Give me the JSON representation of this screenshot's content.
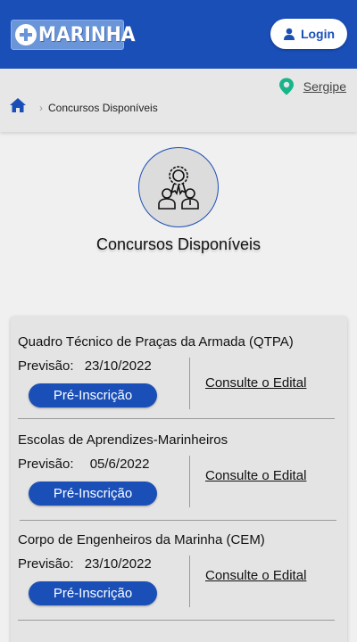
{
  "header": {
    "logo_text": "MARINHA",
    "login_label": "Login",
    "colors": {
      "primary": "#1a4fb8",
      "logo_bg": "#6a95d9",
      "location_pin": "#16b58a"
    }
  },
  "breadcrumb": {
    "location": "Sergipe",
    "current": "Concursos Disponíveis"
  },
  "hero": {
    "title": "Concursos Disponíveis"
  },
  "concursos": [
    {
      "title": "Quadro Técnico de Praças da Armada (QTPA)",
      "previsao_label": "Previsão:",
      "previsao_date": "23/10/2022",
      "button": "Pré-Inscrição",
      "edital": "Consulte o Edital"
    },
    {
      "title": "Escolas de Aprendizes-Marinheiros",
      "previsao_label": "Previsão:",
      "previsao_date": "05/6/2022",
      "button": "Pré-Inscrição",
      "edital": "Consulte o Edital"
    },
    {
      "title": "Corpo de Engenheiros da Marinha (CEM)",
      "previsao_label": "Previsão:",
      "previsao_date": "23/10/2022",
      "button": "Pré-Inscrição",
      "edital": "Consulte o Edital"
    }
  ]
}
